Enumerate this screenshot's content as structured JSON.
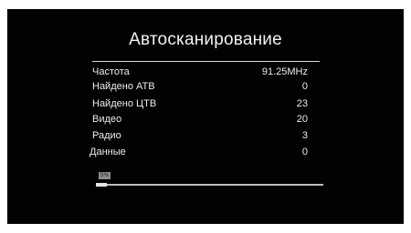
{
  "dialog": {
    "title": "Автосканирование"
  },
  "rows": [
    {
      "label": "Частота",
      "value": "91.25MHz"
    },
    {
      "label": "Найдено АТВ",
      "value": "0"
    },
    {
      "label": "Найдено ЦТВ",
      "value": "23"
    },
    {
      "label": "Видео",
      "value": "20"
    },
    {
      "label": "Радио",
      "value": "3"
    },
    {
      "label": "Данные",
      "value": "0"
    }
  ],
  "progress": {
    "percent_text": "5%",
    "fraction": 0.05
  },
  "colors": {
    "background": "#020202",
    "text": "#ececec",
    "progress_track": "#bdbdbd"
  }
}
